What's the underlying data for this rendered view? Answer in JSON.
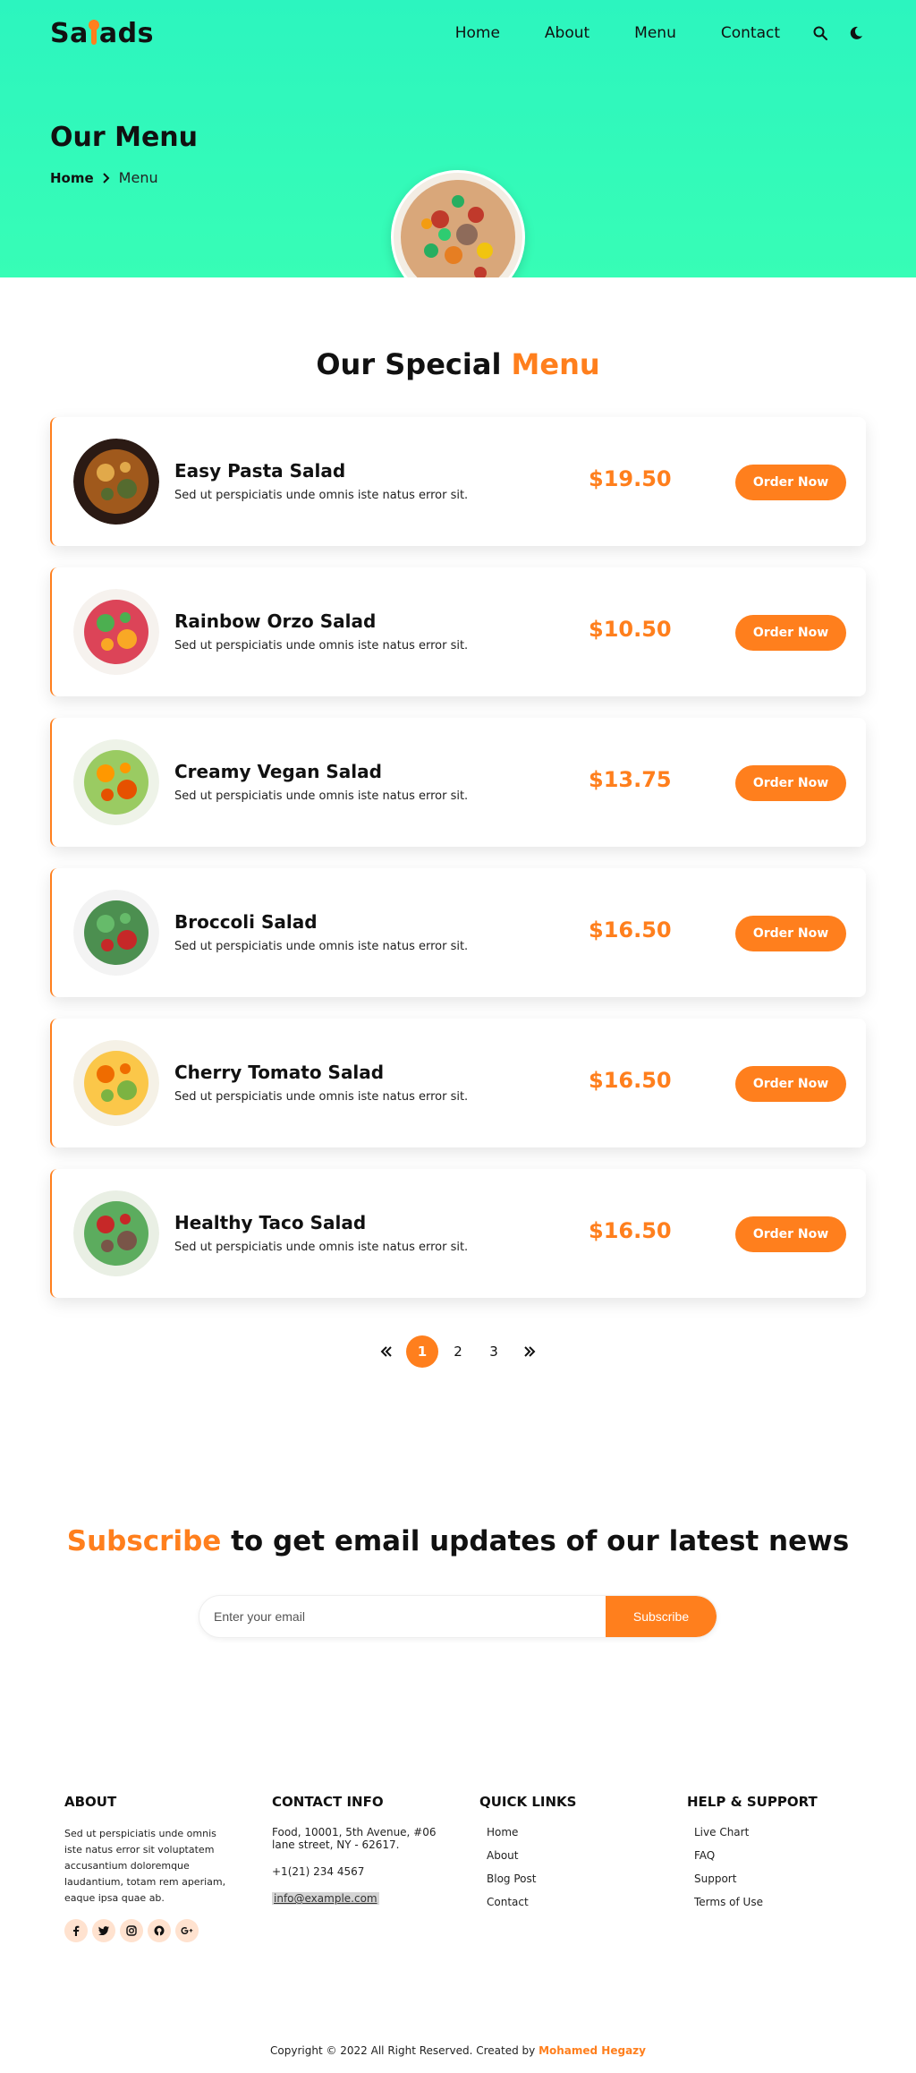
{
  "header": {
    "logo_text_left": "Sa",
    "logo_text_right": "ads",
    "nav": [
      "Home",
      "About",
      "Menu",
      "Contact"
    ],
    "icons": [
      "search-icon",
      "moon-icon"
    ]
  },
  "hero": {
    "title": "Our Menu",
    "breadcrumb_home": "Home",
    "breadcrumb_current": "Menu"
  },
  "menu_section": {
    "title_main": "Our Special ",
    "title_accent": "Menu",
    "order_label": "Order Now",
    "items": [
      {
        "name": "Easy Pasta Salad",
        "desc": "Sed ut perspiciatis unde omnis iste natus error sit.",
        "price": "$19.50"
      },
      {
        "name": "Rainbow Orzo Salad",
        "desc": "Sed ut perspiciatis unde omnis iste natus error sit.",
        "price": "$10.50"
      },
      {
        "name": "Creamy Vegan Salad",
        "desc": "Sed ut perspiciatis unde omnis iste natus error sit.",
        "price": "$13.75"
      },
      {
        "name": "Broccoli Salad",
        "desc": "Sed ut perspiciatis unde omnis iste natus error sit.",
        "price": "$16.50"
      },
      {
        "name": "Cherry Tomato Salad",
        "desc": "Sed ut perspiciatis unde omnis iste natus error sit.",
        "price": "$16.50"
      },
      {
        "name": "Healthy Taco Salad",
        "desc": "Sed ut perspiciatis unde omnis iste natus error sit.",
        "price": "$16.50"
      }
    ]
  },
  "pagination": {
    "pages": [
      "1",
      "2",
      "3"
    ],
    "active": "1"
  },
  "subscribe": {
    "title_accent": "Subscribe",
    "title_rest": " to get email updates of our latest news",
    "placeholder": "Enter your email",
    "button": "Subscribe"
  },
  "footer": {
    "about": {
      "heading": "ABOUT",
      "text": "Sed ut perspiciatis unde omnis iste natus error sit voluptatem accusantium doloremque laudantium, totam rem aperiam, eaque ipsa quae ab."
    },
    "contact": {
      "heading": "CONTACT INFO",
      "address": "Food, 10001, 5th Avenue, #06 lane street, NY - 62617.",
      "phone": "+1(21) 234 4567",
      "email": "info@example.com"
    },
    "quick_links": {
      "heading": "QUICK LINKS",
      "items": [
        "Home",
        "About",
        "Blog Post",
        "Contact"
      ]
    },
    "help": {
      "heading": "HELP & SUPPORT",
      "items": [
        "Live Chart",
        "FAQ",
        "Support",
        "Terms of Use"
      ]
    },
    "socials": [
      "facebook-icon",
      "twitter-icon",
      "instagram-icon",
      "github-icon",
      "google-plus-icon"
    ],
    "copyright_text": "Copyright © 2022 All Right Reserved. Created by ",
    "copyright_author": "Mohamed Hegazy"
  },
  "colors": {
    "accent": "#ff7f1d",
    "hero_bg": "#2cf5bf"
  }
}
